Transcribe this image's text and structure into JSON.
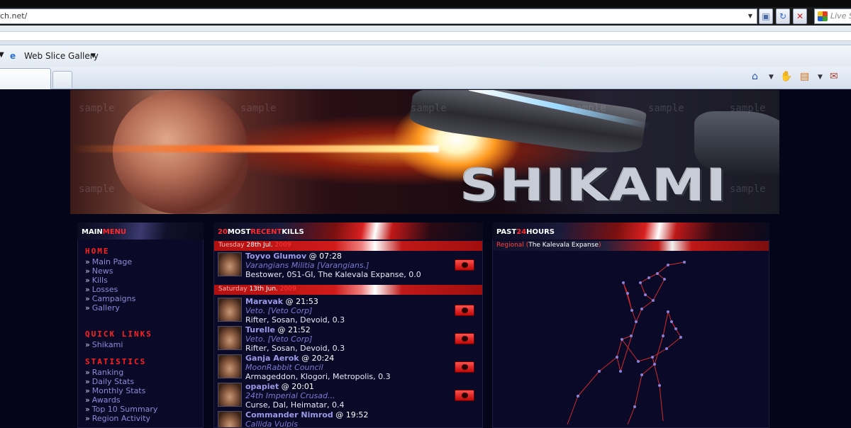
{
  "browser": {
    "address_fragment": "ch.net/",
    "search_placeholder": "Live S",
    "favorites_item": "Web Slice Gallery"
  },
  "banner": {
    "logo_text": "SHIKAMI",
    "watermark": "sample"
  },
  "main_menu": {
    "title_a": "MAIN",
    "title_b": "MENU",
    "sections": [
      {
        "title": "HOME",
        "items": [
          "Main Page",
          "News",
          "Kills",
          "Losses",
          "Campaigns",
          "Gallery"
        ]
      },
      {
        "title": "QUICK LINKS",
        "items": [
          "Shikami"
        ]
      },
      {
        "title": "STATISTICS",
        "items": [
          "Ranking",
          "Daily Stats",
          "Monthly Stats",
          "Awards",
          "Top 10 Summary",
          "Region Activity"
        ]
      }
    ]
  },
  "kills_panel": {
    "title_a": "20",
    "title_b": "MOST",
    "title_c": "RECENT",
    "title_d": "KILLS",
    "groups": [
      {
        "day": "Tuesday",
        "date": "28th Jul.",
        "year": "2009",
        "kills": [
          {
            "pilot": "Toyvo Glumov",
            "time": "@ 07:28",
            "corp": "Varangians Militia [Varangians.]",
            "location": "Bestower, 0S1-GI, The Kalevala Expanse, 0.0"
          }
        ]
      },
      {
        "day": "Saturday",
        "date": "13th Jun.",
        "year": "2009",
        "kills": [
          {
            "pilot": "Maravak",
            "time": "@ 21:53",
            "corp": "Veto. [Veto Corp]",
            "location": "Rifter, Sosan, Devoid, 0.3"
          },
          {
            "pilot": "Turelle",
            "time": "@ 21:52",
            "corp": "Veto. [Veto Corp]",
            "location": "Rifter, Sosan, Devoid, 0.3"
          },
          {
            "pilot": "Ganja Aerok",
            "time": "@ 20:24",
            "corp": "MoonRabbit Council",
            "location": "Armageddon, Klogori, Metropolis, 0.3"
          },
          {
            "pilot": "opapiet",
            "time": "@ 20:01",
            "corp": "24th Imperial Crusad...",
            "location": "Curse, Dal, Heimatar, 0.4"
          },
          {
            "pilot": "Commander Nimrod",
            "time": "@ 19:52",
            "corp": "Callida Vulpis",
            "location": ""
          }
        ]
      }
    ]
  },
  "past_panel": {
    "title_a": "PAST",
    "title_b": "24",
    "title_c": "HOURS",
    "region_label": "Regional",
    "region_name": "The Kalevala Expanse"
  },
  "colors": {
    "accent_red": "#ff2020",
    "link": "#8a8ad8",
    "background": "#05051a"
  }
}
